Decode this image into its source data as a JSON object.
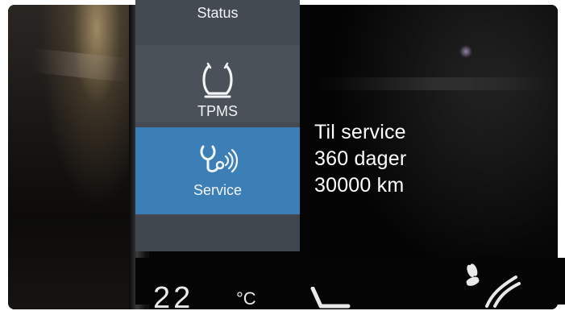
{
  "menu": {
    "items": [
      {
        "label": "Status",
        "icon": "status-icon"
      },
      {
        "label": "TPMS",
        "icon": "tire-pressure-icon"
      },
      {
        "label": "Service",
        "icon": "service-wrench-icon",
        "selected": true
      }
    ]
  },
  "info": {
    "line1": "Til service",
    "line2": "360 dager",
    "line3": "30000 km"
  },
  "climate": {
    "temperature_partial": "22",
    "unit": "°C",
    "seat_icon": "seat-heat-icon",
    "fan_icon": "fan-icon"
  },
  "colors": {
    "menu_background": "#434a52",
    "selected_item": "#3c7fb6",
    "text": "#ffffff"
  }
}
